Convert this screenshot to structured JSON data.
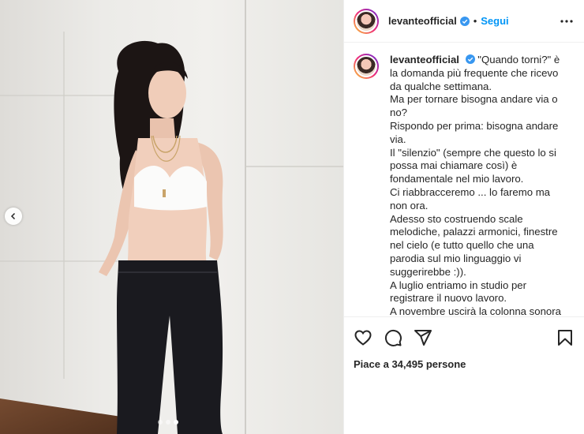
{
  "post": {
    "username": "levanteofficial",
    "follow_label": "Segui",
    "bullet": "•",
    "caption_lines": [
      "\"Quando torni?\" è la domanda più frequente che ricevo da qualche settimana.",
      "Ma per tornare bisogna andare via o no?",
      "Rispondo per prima: bisogna andare via.",
      "Il \"silenzio\" (sempre che questo lo si possa mai chiamare così) è fondamentale nel mio lavoro.",
      "Ci riabbracceremo ... lo faremo ma non ora.",
      "Adesso sto costruendo scale melodiche, palazzi armonici, finestre nel cielo (e tutto quello che una parodia sul mio linguaggio vi suggerirebbe :)).",
      "A luglio entriamo in studio per registrare il nuovo lavoro.",
      "A novembre uscirà la colonna sonora"
    ],
    "likes_prefix": "Piace a",
    "likes_count": "34,495",
    "likes_suffix": "persone"
  },
  "carousel": {
    "count": 3,
    "active_index": 2
  },
  "colors": {
    "link": "#0095f6",
    "verified": "#3897f0",
    "text": "#262626"
  },
  "icons": {
    "avatar": "avatar",
    "verified": "verified-badge-icon",
    "more": "more-options-icon",
    "like": "heart-icon",
    "comment": "comment-icon",
    "share": "share-icon",
    "save": "bookmark-icon",
    "prev": "chevron-left-icon"
  }
}
